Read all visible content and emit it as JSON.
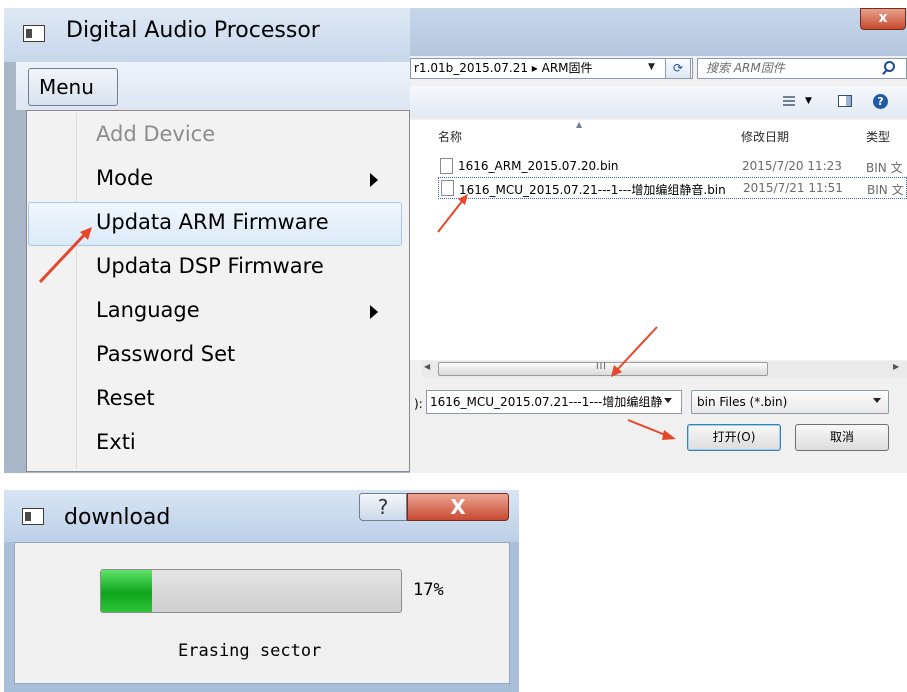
{
  "app_window": {
    "title": "Digital Audio Processor",
    "menu_label": "Menu",
    "menu_items": [
      {
        "label": "Add Device",
        "state": "disabled",
        "submenu": false
      },
      {
        "label": "Mode",
        "state": "normal",
        "submenu": true
      },
      {
        "label": "Updata ARM Firmware",
        "state": "highlighted",
        "submenu": false
      },
      {
        "label": "Updata DSP Firmware",
        "state": "normal",
        "submenu": false
      },
      {
        "label": "Language",
        "state": "normal",
        "submenu": true
      },
      {
        "label": "Password Set",
        "state": "normal",
        "submenu": false
      },
      {
        "label": "Reset",
        "state": "normal",
        "submenu": false
      },
      {
        "label": "Exti",
        "state": "normal",
        "submenu": false
      }
    ]
  },
  "file_dialog": {
    "close_glyph": "x",
    "address_path": "r1.01b_2015.07.21 ▸ ARM固件",
    "search_placeholder": "搜索 ARM固件",
    "help_glyph": "?",
    "columns": {
      "name": "名称",
      "modified": "修改日期",
      "type": "类型"
    },
    "files": [
      {
        "name": "1616_ARM_2015.07.20.bin",
        "modified": "2015/7/20 11:23",
        "type": "BIN 文",
        "selected": false
      },
      {
        "name": "1616_MCU_2015.07.21---1---增加编组静音.bin",
        "modified": "2015/7/21 11:51",
        "type": "BIN 文",
        "selected": true
      }
    ],
    "scroll_grip": "III",
    "filename_label": "):",
    "filename_value": "1616_MCU_2015.07.21---1---增加编组静",
    "filetype_value": "bin Files (*.bin)",
    "open_button": "打开(O)",
    "cancel_button": "取消"
  },
  "download_dialog": {
    "title": "download",
    "help_glyph": "?",
    "close_glyph": "X",
    "progress": 0.17,
    "progress_text": "17%",
    "status": "Erasing sector"
  },
  "colors": {
    "annotation_arrow": "#e8462a",
    "progress_green": "#19b528",
    "menu_highlight": "#dceaf8"
  }
}
